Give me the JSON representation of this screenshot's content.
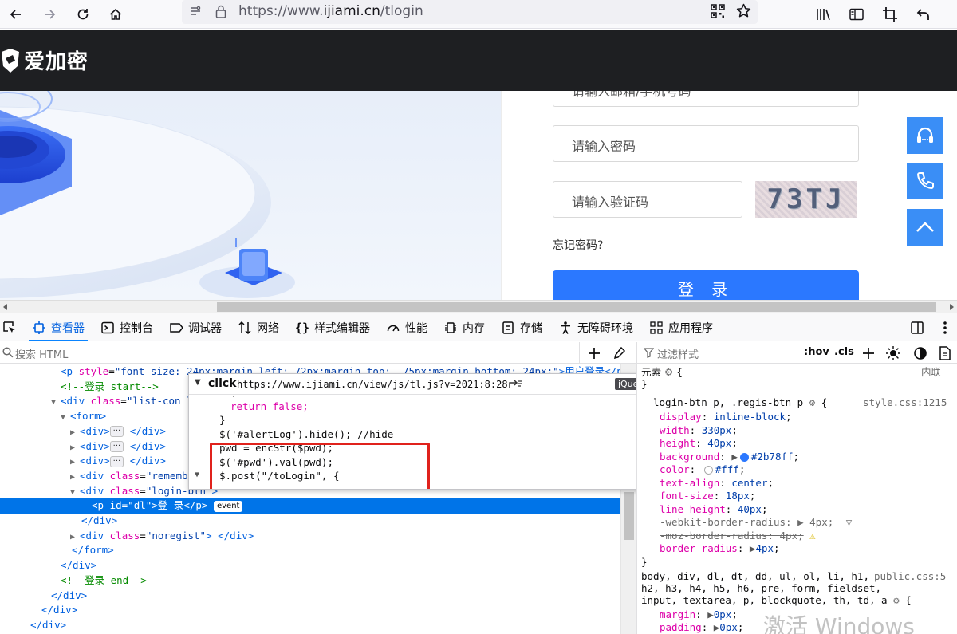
{
  "browser": {
    "url_prefix": "https://www.",
    "url_host": "ijiami.cn",
    "url_path": "/tlogin"
  },
  "site": {
    "logo_text": "爱加密",
    "login": {
      "account_placeholder": "请输入邮箱/手机号码",
      "password_placeholder": "请输入密码",
      "captcha_placeholder": "请输入验证码",
      "captcha_text": "73TJ",
      "forgot": "忘记密码?",
      "submit": "登 录"
    }
  },
  "devtools": {
    "tabs": [
      {
        "label": "查看器",
        "icon": "inspector-icon"
      },
      {
        "label": "控制台",
        "icon": "console-icon"
      },
      {
        "label": "调试器",
        "icon": "debugger-icon"
      },
      {
        "label": "网络",
        "icon": "network-icon"
      },
      {
        "label": "样式编辑器",
        "icon": "style-editor-icon"
      },
      {
        "label": "性能",
        "icon": "performance-icon"
      },
      {
        "label": "内存",
        "icon": "memory-icon"
      },
      {
        "label": "存储",
        "icon": "storage-icon"
      },
      {
        "label": "无障碍环境",
        "icon": "accessibility-icon"
      },
      {
        "label": "应用程序",
        "icon": "application-icon"
      }
    ],
    "html_search_placeholder": "搜索 HTML",
    "rules_filter_placeholder": "过滤样式",
    "hov": ":hov",
    "cls": ".cls",
    "tree": [
      {
        "l0": "<p ",
        "a1": "style",
        "v1": "\"font-size: 24px;margin-left: 72px;margin-top: -75px;margin-bottom: 24px;\"",
        "t": ">用户登录</p>"
      },
      {
        "comment": "<!--登录 start-->"
      },
      {
        "l0": "<div ",
        "a1": "class",
        "v1": "\"list-con lo",
        "t": ""
      },
      {
        "l0": "<form>"
      },
      {
        "l0": "<div>",
        "t": " </div>"
      },
      {
        "l0": "<div>",
        "t": " </div>"
      },
      {
        "l0": "<div>",
        "t": " </div>"
      },
      {
        "l0": "<div ",
        "a1": "class",
        "v1": "\"remembe",
        "t": ""
      },
      {
        "l0": "<div ",
        "a1": "class",
        "v1": "\"login-btn\"",
        "t": ">"
      },
      {
        "l0": "<p ",
        "a1": "id",
        "v1": "\"dl\"",
        "t": ">登 录</p>",
        "badge": "event"
      },
      {
        "l0": "</div>"
      },
      {
        "l0": "<div ",
        "a1": "class",
        "v1": "\"noregist\"",
        "t": "> </div>"
      },
      {
        "l0": "</form>"
      },
      {
        "l0": "</div>"
      },
      {
        "comment": "<!--登录 end-->"
      },
      {
        "l0": "</div>"
      },
      {
        "l0": "</div>"
      },
      {
        "l0": "</div>"
      }
    ],
    "popup": {
      "event": "click",
      "url": "https://www.ijiami.cn/view/js/tl.js?v=2021:8:28",
      "lib": "jQuery",
      "code": [
        "return false;",
        "}",
        "$('#alertLog').hide(); //hide",
        "pwd = encStr($pwd);",
        "$('#pwd').val(pwd);",
        "$.post(\"/toLogin\", {"
      ]
    },
    "rules": {
      "element_label": "元素",
      "inline_label": "内联",
      "rule1_selector": "login-btn p, .regis-btn p",
      "rule1_source": "style.css:1215",
      "rule1_props": [
        {
          "p": "display",
          "v": "inline-block"
        },
        {
          "p": "width",
          "v": "330px"
        },
        {
          "p": "height",
          "v": "40px"
        },
        {
          "p": "background",
          "v": "#2b78ff"
        },
        {
          "p": "color",
          "v": "#fff"
        },
        {
          "p": "text-align",
          "v": "center"
        },
        {
          "p": "font-size",
          "v": "18px"
        },
        {
          "p": "line-height",
          "v": "40px"
        },
        {
          "p": "-webkit-border-radius",
          "v": "4px"
        },
        {
          "p": "-moz-border-radius",
          "v": "4px"
        },
        {
          "p": "border-radius",
          "v": "4px"
        }
      ],
      "rule2_selector_1": "body, div, dl, dt, dd, ul, ol, li, h1,",
      "rule2_selector_2": "h2, h3, h4, h5, h6, pre, form, fieldset,",
      "rule2_selector_3": "input, textarea, p, blockquote, th, td, a",
      "rule2_source": "public.css:5",
      "rule2_props": [
        {
          "p": "margin",
          "v": "0px"
        },
        {
          "p": "padding",
          "v": "0px"
        }
      ],
      "watermark": "激活 Windows"
    }
  }
}
